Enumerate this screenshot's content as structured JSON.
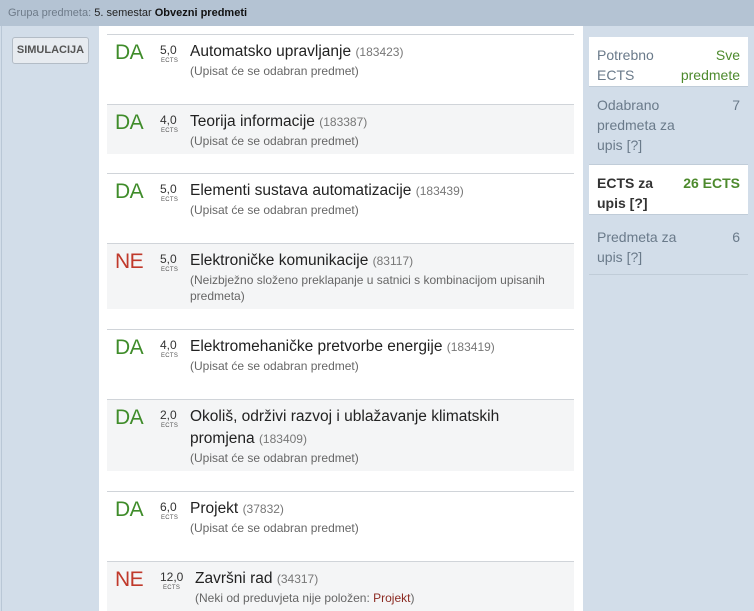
{
  "header": {
    "label": "Grupa predmeta:",
    "semester": "5. semestar",
    "group": "Obvezni predmeti"
  },
  "actions": {
    "simulate_label": "SIMULACIJA"
  },
  "ects_unit": "ECTS",
  "courses": [
    {
      "status": "DA",
      "ects": "5,0",
      "name": "Automatsko upravljanje",
      "code": "(183423)",
      "note": "(Upisat će se odabran predmet)"
    },
    {
      "status": "DA",
      "ects": "4,0",
      "name": "Teorija informacije",
      "code": "(183387)",
      "note": "(Upisat će se odabran predmet)"
    },
    {
      "status": "DA",
      "ects": "5,0",
      "name": "Elementi sustava automatizacije",
      "code": "(183439)",
      "note": "(Upisat će se odabran predmet)"
    },
    {
      "status": "NE",
      "ects": "5,0",
      "name": "Elektroničke komunikacije",
      "code": "(83117)",
      "note": "(Neizbježno složeno preklapanje u satnici s kombinacijom upisanih predmeta)"
    },
    {
      "status": "DA",
      "ects": "4,0",
      "name": "Elektromehaničke pretvorbe energije",
      "code": "(183419)",
      "note": "(Upisat će se odabran predmet)"
    },
    {
      "status": "DA",
      "ects": "2,0",
      "name": "Okoliš, održivi razvoj i ublažavanje klimatskih promjena",
      "code": "(183409)",
      "note": "(Upisat će se odabran predmet)"
    },
    {
      "status": "DA",
      "ects": "6,0",
      "name": "Projekt",
      "code": "(37832)",
      "note": "(Upisat će se odabran predmet)"
    },
    {
      "status": "NE",
      "ects": "12,0",
      "name": "Završni rad",
      "code": "(34317)",
      "note_prefix": "(Neki od preduvjeta nije položen: ",
      "note_link": "Projekt",
      "note_suffix": ")"
    }
  ],
  "stats": [
    {
      "key": "Potrebno ECTS",
      "value": "Sve predmete"
    },
    {
      "key": "Odabrano predmeta za upis [?]",
      "value": "7"
    },
    {
      "key": "ECTS za upis [?]",
      "value": "26 ECTS"
    },
    {
      "key": "Predmeta za upis [?]",
      "value": "6"
    }
  ],
  "colors": {
    "yes": "#3f8c2a",
    "no": "#c0392b",
    "header_bg": "#b4c3d3",
    "panel_bg": "#d2dde9"
  }
}
